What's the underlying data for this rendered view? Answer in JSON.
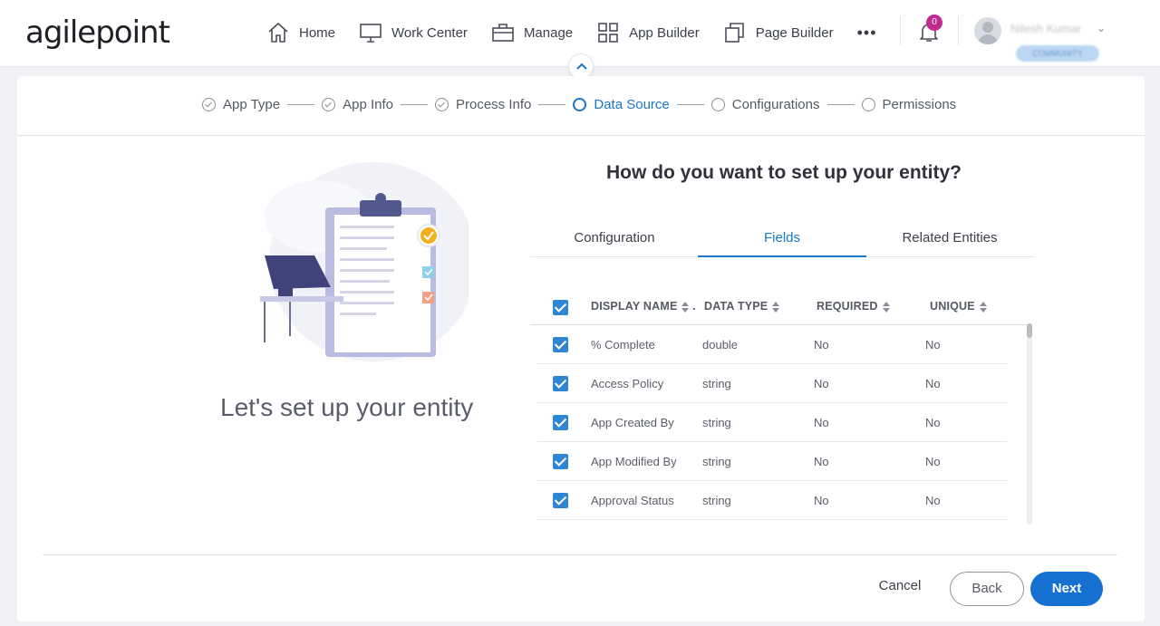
{
  "app": {
    "logo_text": "agilepoint"
  },
  "nav": {
    "items": [
      {
        "label": "Home",
        "icon": "home-icon"
      },
      {
        "label": "Work Center",
        "icon": "monitor-icon"
      },
      {
        "label": "Manage",
        "icon": "briefcase-icon"
      },
      {
        "label": "App Builder",
        "icon": "grid-icon"
      },
      {
        "label": "Page Builder",
        "icon": "pages-icon"
      }
    ],
    "more_label": "•••",
    "notification_count": "0",
    "user_name": "Nilesh Kumar",
    "user_badge": "COMMUNITY"
  },
  "stepper": {
    "steps": [
      {
        "label": "App Type",
        "state": "done"
      },
      {
        "label": "App Info",
        "state": "done"
      },
      {
        "label": "Process Info",
        "state": "done"
      },
      {
        "label": "Data Source",
        "state": "active"
      },
      {
        "label": "Configurations",
        "state": "pending"
      },
      {
        "label": "Permissions",
        "state": "pending"
      }
    ]
  },
  "left": {
    "heading": "Let's set up your entity"
  },
  "main": {
    "question": "How do you want to set up your entity?",
    "tabs": [
      {
        "label": "Configuration"
      },
      {
        "label": "Fields"
      },
      {
        "label": "Related Entities"
      }
    ],
    "active_tab": "Fields",
    "columns": [
      "DISPLAY NAME",
      "DATA TYPE",
      "REQUIRED",
      "UNIQUE"
    ],
    "rows": [
      {
        "name": "% Complete",
        "type": "double",
        "required": "No",
        "unique": "No"
      },
      {
        "name": "Access Policy",
        "type": "string",
        "required": "No",
        "unique": "No"
      },
      {
        "name": "App Created By",
        "type": "string",
        "required": "No",
        "unique": "No"
      },
      {
        "name": "App Modified By",
        "type": "string",
        "required": "No",
        "unique": "No"
      },
      {
        "name": "Approval Status",
        "type": "string",
        "required": "No",
        "unique": "No"
      }
    ]
  },
  "footer": {
    "cancel": "Cancel",
    "back": "Back",
    "next": "Next"
  },
  "colors": {
    "accent": "#1a76c9",
    "primary_button": "#1570d2",
    "badge": "#c02b8f"
  }
}
